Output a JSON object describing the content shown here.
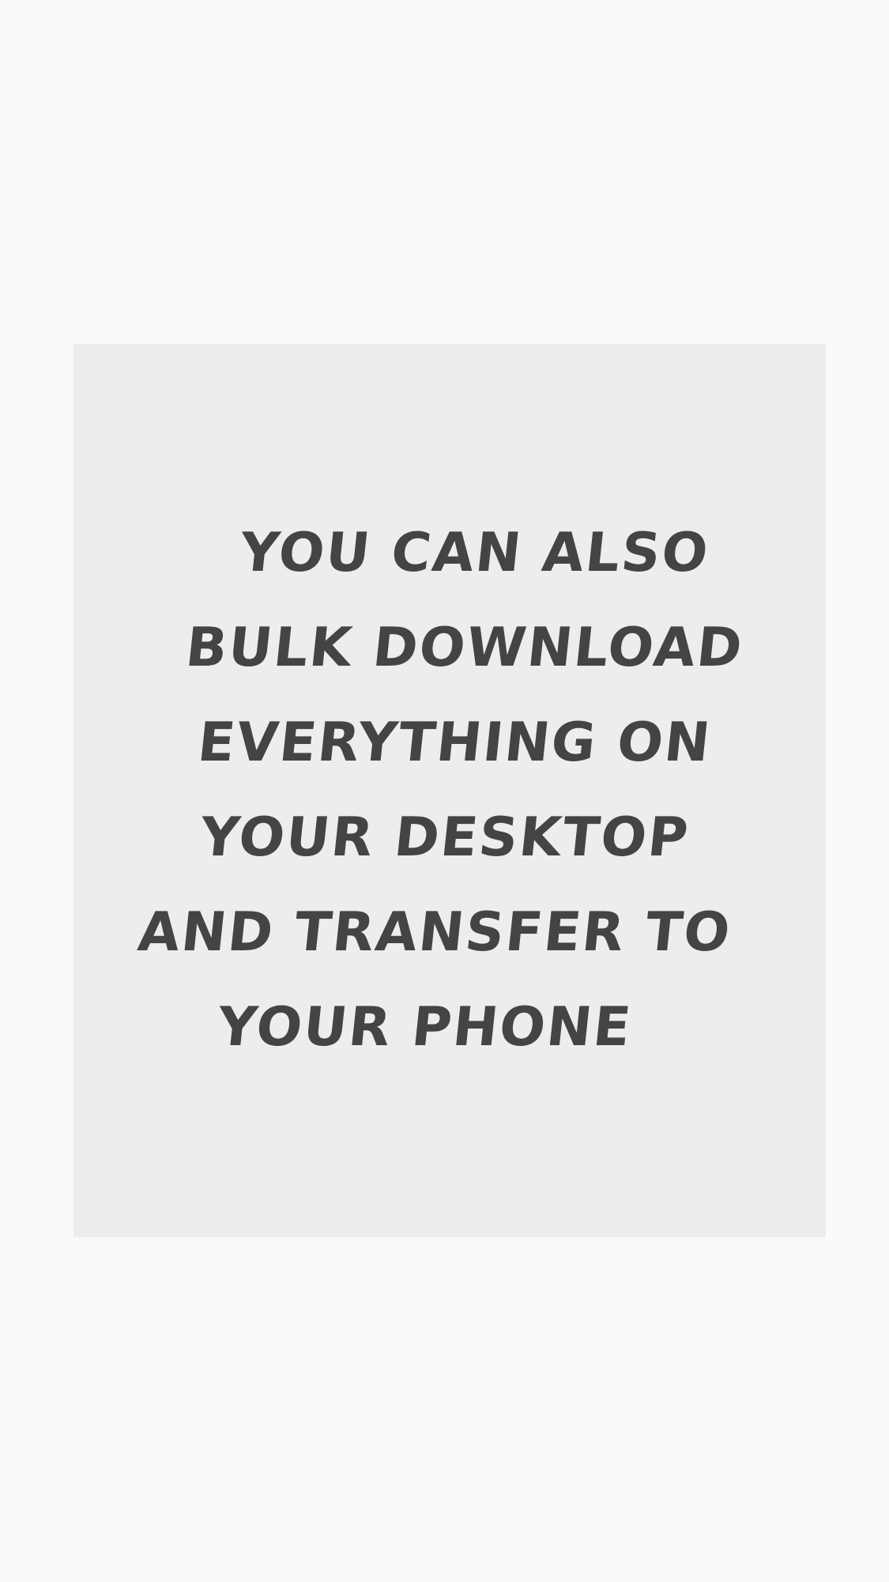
{
  "card": {
    "message_lines": [
      "You can also",
      "bulk download",
      "everything on",
      "your desktop",
      "and transfer to",
      "your phone"
    ]
  },
  "colors": {
    "page_background": "#fafafa",
    "card_background": "#ededed",
    "text": "#444444"
  }
}
